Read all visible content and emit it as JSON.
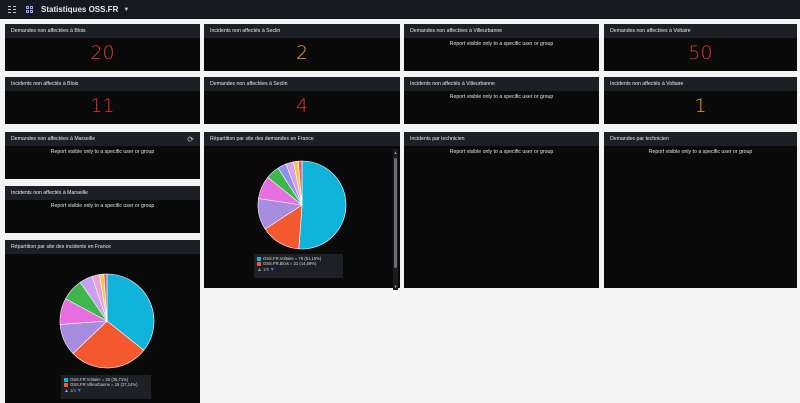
{
  "header": {
    "title": "Statistiques OSS.FR"
  },
  "cards": {
    "dem_blois": {
      "title": "Demandes non affectées à Blois",
      "value": "20",
      "color": "#e03a2f"
    },
    "inc_seclin": {
      "title": "Incidents non affectés à Seclin",
      "value": "2",
      "color": "#f0a22b"
    },
    "dem_villeurbanne": {
      "title": "Demandes non affectées à Villeurbanne",
      "message": "Report visible only to a specific user or group"
    },
    "dem_voltaire": {
      "title": "Demandes non affectées à Voltaire",
      "value": "50",
      "color": "#e03a2f"
    },
    "inc_blois": {
      "title": "Incidents non affectés à Blois",
      "value": "11",
      "color": "#e03a2f"
    },
    "dem_seclin": {
      "title": "Demandes non affectées à Seclin",
      "value": "4",
      "color": "#e03a2f"
    },
    "inc_villeurbanne": {
      "title": "Incidents non affectés à Villeurbanne",
      "message": "Report visible only to a specific user or group"
    },
    "inc_voltaire": {
      "title": "Incidents non affectés à Voltaire",
      "value": "1",
      "color": "#f0a22b"
    },
    "dem_marseille": {
      "title": "Demandes non affectées à Marseille",
      "message": "Report visible only to a specific user or group"
    },
    "inc_marseille": {
      "title": "Incidents non affectés à Marseille",
      "message": "Report visible only to a specific user or group"
    },
    "inc_tech": {
      "title": "Incidents par technicien",
      "message": "Report visible only to a specific user or group"
    },
    "dem_tech": {
      "title": "Demandes par technicien",
      "message": "Report visible only to a specific user or group"
    }
  },
  "charts_text": {
    "demandes": {
      "title": "Répartition par site des demandes en France",
      "legend": [
        "OSS.FR.Voltaire = 76 (51,15%)",
        "OSS.FR.Blois = 21 (14,69%)"
      ],
      "page": "1/9"
    },
    "incidents": {
      "title": "Répartition par site des incidents en France",
      "legend": [
        "OSS.FR.Voltaire = 25 (35,71%)",
        "OSS.FR.Villeurbanne = 19 (27,14%)"
      ],
      "page": "1/4"
    }
  },
  "chart_data": [
    {
      "type": "pie",
      "title": "Répartition par site des demandes en France",
      "series": [
        {
          "name": "OSS.FR.Voltaire",
          "values": [
            76
          ],
          "pct": 51.15,
          "color": "#10b4da"
        },
        {
          "name": "OSS.FR.Blois",
          "values": [
            21
          ],
          "pct": 14.69,
          "color": "#f4582e"
        },
        {
          "pct": 11.5,
          "color": "#a88ce0"
        },
        {
          "pct": 8.5,
          "color": "#e76ee0"
        },
        {
          "pct": 5.0,
          "color": "#3fb64a"
        },
        {
          "pct": 3.2,
          "color": "#8f8ff0"
        },
        {
          "pct": 2.8,
          "color": "#d8a0ea"
        },
        {
          "pct": 1.8,
          "color": "#f0c94a"
        },
        {
          "pct": 1.36,
          "color": "#e05b7b"
        }
      ]
    },
    {
      "type": "pie",
      "title": "Répartition par site des incidents en France",
      "series": [
        {
          "name": "OSS.FR.Voltaire",
          "values": [
            25
          ],
          "pct": 35.71,
          "color": "#10b4da"
        },
        {
          "name": "OSS.FR.Villeurbanne",
          "values": [
            19
          ],
          "pct": 27.14,
          "color": "#f4582e"
        },
        {
          "pct": 11.0,
          "color": "#a88ce0"
        },
        {
          "pct": 9.0,
          "color": "#e76ee0"
        },
        {
          "pct": 7.5,
          "color": "#3fb64a"
        },
        {
          "pct": 4.5,
          "color": "#c8a0f2"
        },
        {
          "pct": 2.6,
          "color": "#e8a4d6"
        },
        {
          "pct": 1.5,
          "color": "#f0c94a"
        },
        {
          "pct": 1.05,
          "color": "#e05b7b"
        }
      ]
    }
  ]
}
